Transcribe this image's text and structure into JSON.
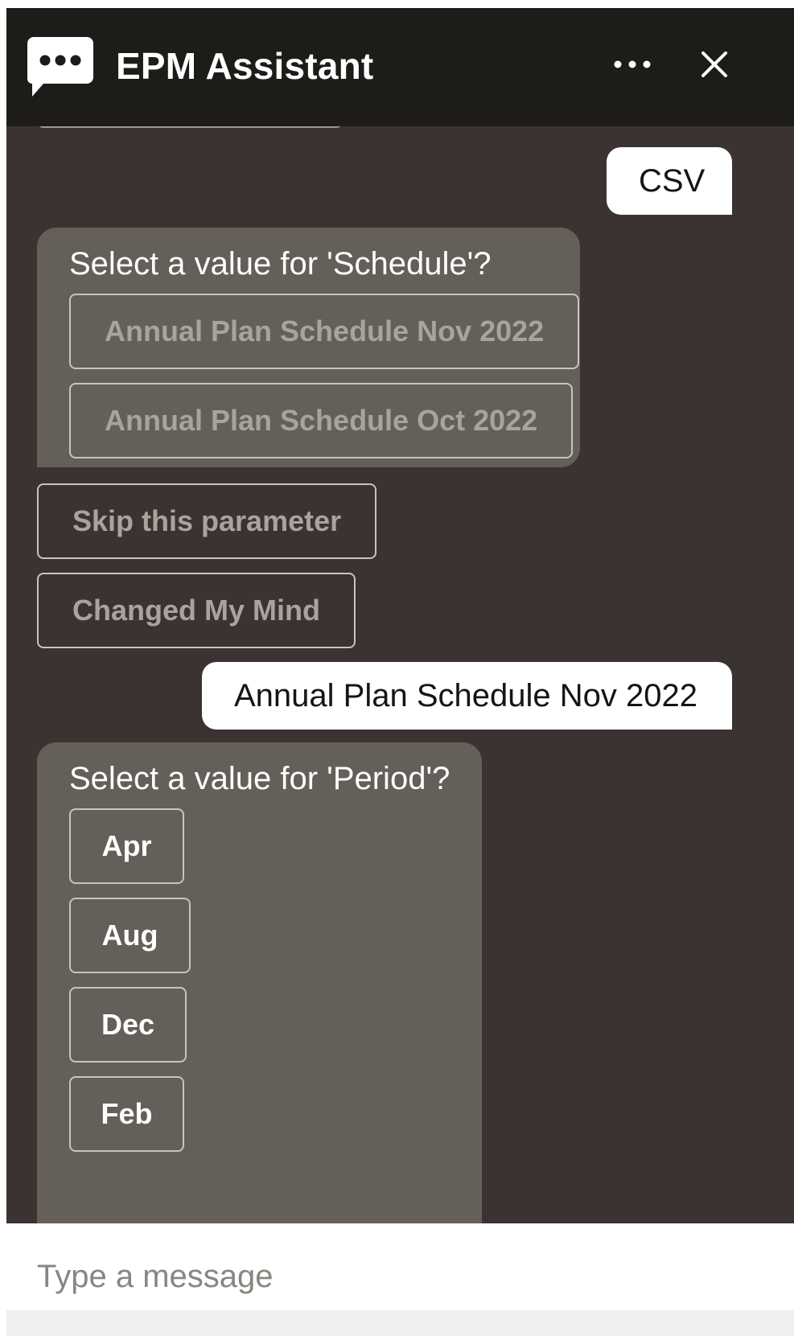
{
  "header": {
    "title": "EPM Assistant",
    "logo_icon": "chat-bubble-icon",
    "more_icon": "more-options-icon",
    "close_icon": "close-icon",
    "background": "#1d1c19"
  },
  "conversation": {
    "background": "#3a3331",
    "messages": [
      {
        "type": "user",
        "text": "CSV"
      },
      {
        "type": "bot",
        "prompt": "Select a value for 'Schedule'?",
        "options": [
          "Annual Plan Schedule Nov 2022",
          "Annual Plan Schedule Oct 2022"
        ]
      },
      {
        "type": "actions",
        "items": [
          "Skip this parameter",
          "Changed My Mind"
        ]
      },
      {
        "type": "user",
        "text": "Annual Plan Schedule Nov 2022"
      },
      {
        "type": "bot",
        "prompt": "Select a value for 'Period'?",
        "options": [
          "Apr",
          "Aug",
          "Dec",
          "Feb"
        ]
      }
    ]
  },
  "input": {
    "placeholder": "Type a message",
    "value": ""
  }
}
